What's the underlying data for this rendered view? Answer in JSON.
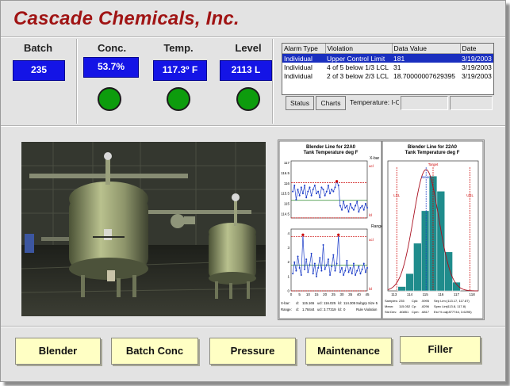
{
  "app": {
    "title": "Cascade Chemicals, Inc."
  },
  "metrics": [
    {
      "label": "Batch",
      "value": "235",
      "indicator": null
    },
    {
      "label": "Conc.",
      "value": "53.7%",
      "indicator": "green"
    },
    {
      "label": "Temp.",
      "value": "117.3º F",
      "indicator": "green"
    },
    {
      "label": "Level",
      "value": "2113 L",
      "indicator": "green"
    }
  ],
  "colors": {
    "title": "#a01414",
    "value_box": "#1414e6",
    "indicator_ok": "#0d9c0d",
    "button": "#ffffc4",
    "selected_row": "#1a2fbf"
  },
  "alarm_table": {
    "columns": [
      "Alarm Type",
      "Violation",
      "Data Value",
      "Date"
    ],
    "rows": [
      [
        "Individual",
        "Upper Control Limit",
        "181",
        "3/19/2003"
      ],
      [
        "Individual",
        "4 of 5 below 1/3 LCL",
        "31",
        "3/19/2003"
      ],
      [
        "Individual",
        "2 of 3 below 2/3 LCL",
        "18.70000007629395",
        "3/19/2003"
      ]
    ],
    "selected_row": 0,
    "buttons": {
      "status": "Status",
      "charts": "Charts"
    },
    "field_label": "Temperature: I-Ch"
  },
  "control_chart": {
    "title_line1": "Blender Line for 22A0",
    "title_line2": "Tank Temperature deg F",
    "xbar_label": "X-bar",
    "range_label": "Range",
    "xbar_ticks": [
      "117",
      "116.5",
      "116",
      "115.5",
      "115",
      "114.5"
    ],
    "range_ticks": [
      "4",
      "3",
      "2",
      "1",
      "0"
    ],
    "x_ticks": [
      "0",
      "5",
      "10",
      "15",
      "20",
      "25",
      "30",
      "35",
      "40",
      "45"
    ],
    "limit_labels": [
      "ucl",
      "lcl",
      "ucl",
      "lcl"
    ],
    "footer": [
      [
        "X-bar:",
        "cl:",
        "115.165",
        "ucl:",
        "116.025",
        "lcl:",
        "114.305",
        "Subgrp Size 5"
      ],
      [
        "Range:",
        "cl:",
        "1.78444",
        "ucl:",
        "3.77319",
        "lcl:",
        "0",
        "Rule Violation"
      ]
    ]
  },
  "histogram": {
    "title_line1": "Blender Line for 22A0",
    "title_line2": "Tank Temperature deg F",
    "labels": {
      "lsl": "LSL",
      "usl": "USL",
      "target": "Target",
      "mean": "Mean"
    },
    "x_ticks": [
      "113",
      "114",
      "115",
      "116",
      "117",
      "118"
    ],
    "footer": [
      [
        "Samples:",
        "235",
        "Cpk:",
        ".5995",
        "Sep Lim:",
        "(113.17, 117.87)"
      ],
      [
        "Mean:",
        "115.052",
        "Cp:",
        ".8296",
        "Spec Lim:",
        "(113.8, 117.8)"
      ],
      [
        "Std Dev:",
        ".80851",
        "Cpm:",
        ".6817",
        "Est % out:",
        "(.877744, 3.6295)"
      ]
    ]
  },
  "chart_data": [
    {
      "type": "line",
      "title": "Blender Line for 22A0 Tank Temperature deg F",
      "ylabel": "X-bar",
      "xlim": [
        0,
        45
      ],
      "ylim": [
        114.3,
        117.1
      ],
      "center_line": 115.165,
      "ucl": 116.025,
      "lcl": 114.305,
      "x": [
        1,
        2,
        3,
        4,
        5,
        6,
        7,
        8,
        9,
        10,
        11,
        12,
        13,
        14,
        15,
        16,
        17,
        18,
        19,
        20,
        21,
        22,
        23,
        24,
        25,
        26,
        27,
        28,
        29,
        30,
        31,
        32,
        33,
        34,
        35,
        36,
        37,
        38,
        39,
        40,
        41,
        42,
        43,
        44,
        45
      ],
      "values": [
        115.6,
        115.9,
        115.2,
        115.7,
        115.4,
        115.8,
        115.5,
        115.9,
        115.3,
        115.6,
        115.8,
        115.4,
        115.7,
        115.9,
        115.5,
        115.6,
        115.3,
        115.8,
        115.7,
        115.4,
        115.6,
        115.9,
        115.5,
        115.7,
        115.6,
        115.8,
        116.1,
        115.9,
        114.9,
        114.7,
        115.1,
        114.8,
        114.9,
        114.6,
        115.0,
        114.8,
        114.7,
        114.9,
        115.1,
        114.6,
        114.8,
        114.9,
        114.7,
        115.0,
        114.8
      ]
    },
    {
      "type": "line",
      "ylabel": "Range",
      "xlim": [
        0,
        45
      ],
      "ylim": [
        0,
        4.3
      ],
      "center_line": 1.78444,
      "ucl": 3.77319,
      "lcl": 0,
      "x": [
        1,
        2,
        3,
        4,
        5,
        6,
        7,
        8,
        9,
        10,
        11,
        12,
        13,
        14,
        15,
        16,
        17,
        18,
        19,
        20,
        21,
        22,
        23,
        24,
        25,
        26,
        27,
        28,
        29,
        30,
        31,
        32,
        33,
        34,
        35,
        36,
        37,
        38,
        39,
        40,
        41,
        42,
        43,
        44,
        45
      ],
      "values": [
        1.2,
        2.0,
        1.4,
        2.4,
        1.6,
        1.1,
        3.9,
        1.5,
        2.2,
        1.3,
        1.8,
        2.6,
        1.2,
        1.9,
        1.0,
        1.6,
        2.3,
        1.4,
        3.2,
        1.5,
        1.8,
        2.2,
        1.1,
        1.7,
        2.5,
        1.4,
        1.9,
        3.9,
        1.3,
        1.6,
        1.1,
        1.4,
        2.1,
        1.3,
        1.6,
        1.2,
        1.9,
        1.1,
        1.4,
        1.7,
        1.2,
        1.5,
        1.9,
        1.3,
        1.6
      ]
    },
    {
      "type": "bar",
      "title": "Blender Line for 22A0 Tank Temperature deg F",
      "xlim": [
        112.6,
        118.4
      ],
      "ylim": [
        0,
        60
      ],
      "lsl": 113.17,
      "usl": 117.87,
      "target": 115.5,
      "mean": 115.052,
      "categories": [
        "113.5",
        "114.0",
        "114.5",
        "115.0",
        "115.5",
        "116.0",
        "116.5",
        "117.0"
      ],
      "values": [
        2,
        8,
        22,
        37,
        53,
        46,
        18,
        4
      ]
    }
  ],
  "buttons": [
    "Blender",
    "Batch Conc",
    "Pressure",
    "Maintenance",
    "Filler"
  ]
}
